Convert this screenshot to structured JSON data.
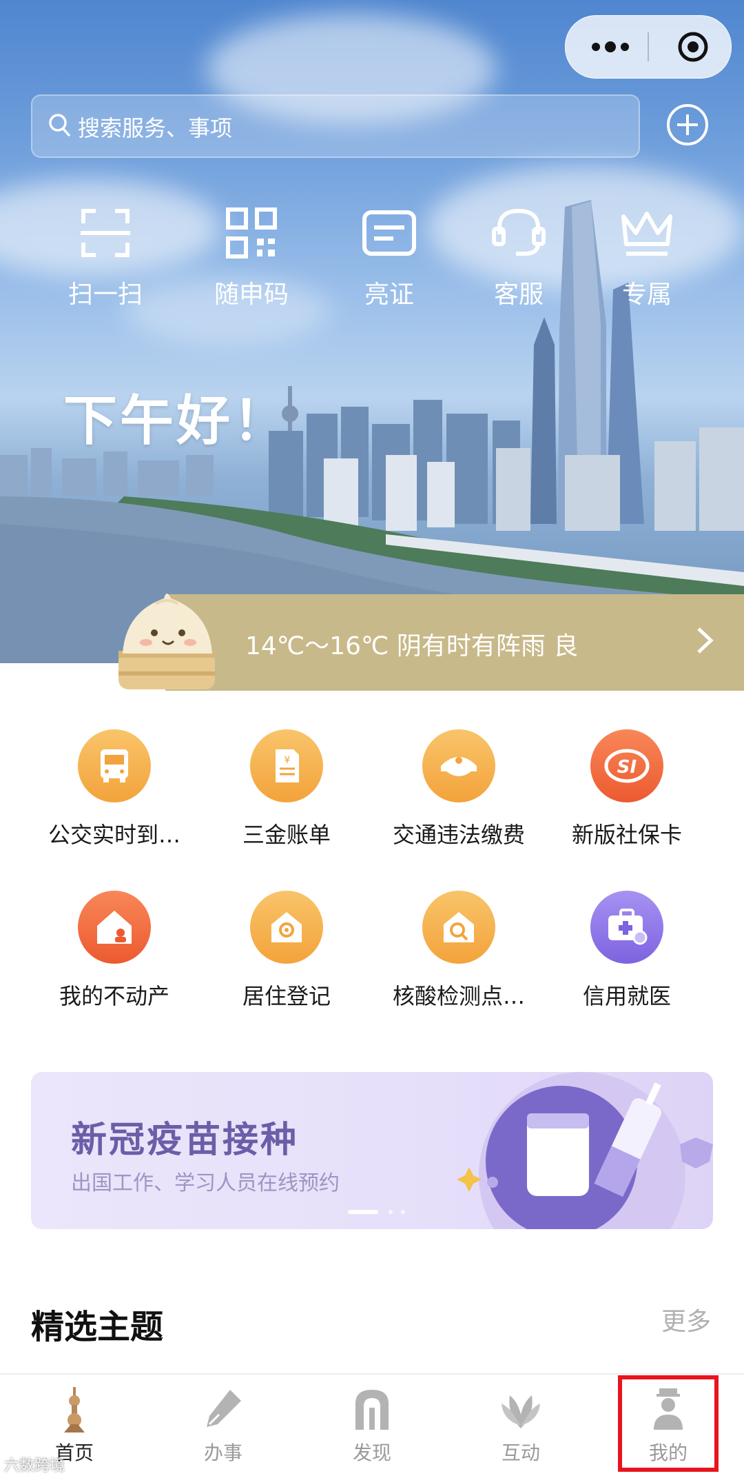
{
  "header": {
    "search_placeholder": "搜索服务、事项"
  },
  "quick_actions": [
    {
      "label": "扫一扫",
      "icon": "scan-icon"
    },
    {
      "label": "随申码",
      "icon": "qrcode-icon"
    },
    {
      "label": "亮证",
      "icon": "id-card-icon"
    },
    {
      "label": "客服",
      "icon": "headset-icon"
    },
    {
      "label": "专属",
      "icon": "crown-icon"
    }
  ],
  "greeting": "下午好！",
  "weather": {
    "text": "14℃～16℃ 阴有时有阵雨 良"
  },
  "services": [
    {
      "label": "公交实时到…",
      "icon": "bus-icon",
      "color": "#f5a843"
    },
    {
      "label": "三金账单",
      "icon": "bill-icon",
      "color": "#f5a843"
    },
    {
      "label": "交通违法缴费",
      "icon": "police-cap-icon",
      "color": "#f5a843"
    },
    {
      "label": "新版社保卡",
      "icon": "social-security-icon",
      "color": "#f0663c"
    },
    {
      "label": "我的不动产",
      "icon": "house-icon",
      "color": "#f0663c"
    },
    {
      "label": "居住登记",
      "icon": "home-register-icon",
      "color": "#f5a843"
    },
    {
      "label": "核酸检测点…",
      "icon": "test-site-icon",
      "color": "#f5a843"
    },
    {
      "label": "信用就医",
      "icon": "medical-kit-icon",
      "color": "#8c74e6"
    }
  ],
  "promo_banner": {
    "title": "新冠疫苗接种",
    "subtitle": "出国工作、学习人员在线预约"
  },
  "section": {
    "title": "精选主题",
    "more": "更多"
  },
  "tabbar": [
    {
      "label": "首页",
      "icon": "tower-icon",
      "active": true
    },
    {
      "label": "办事",
      "icon": "pen-icon",
      "active": false
    },
    {
      "label": "发现",
      "icon": "arch-icon",
      "active": false
    },
    {
      "label": "互动",
      "icon": "magnolia-icon",
      "active": false
    },
    {
      "label": "我的",
      "icon": "user-icon",
      "active": false
    }
  ],
  "watermark": "六数跨境"
}
